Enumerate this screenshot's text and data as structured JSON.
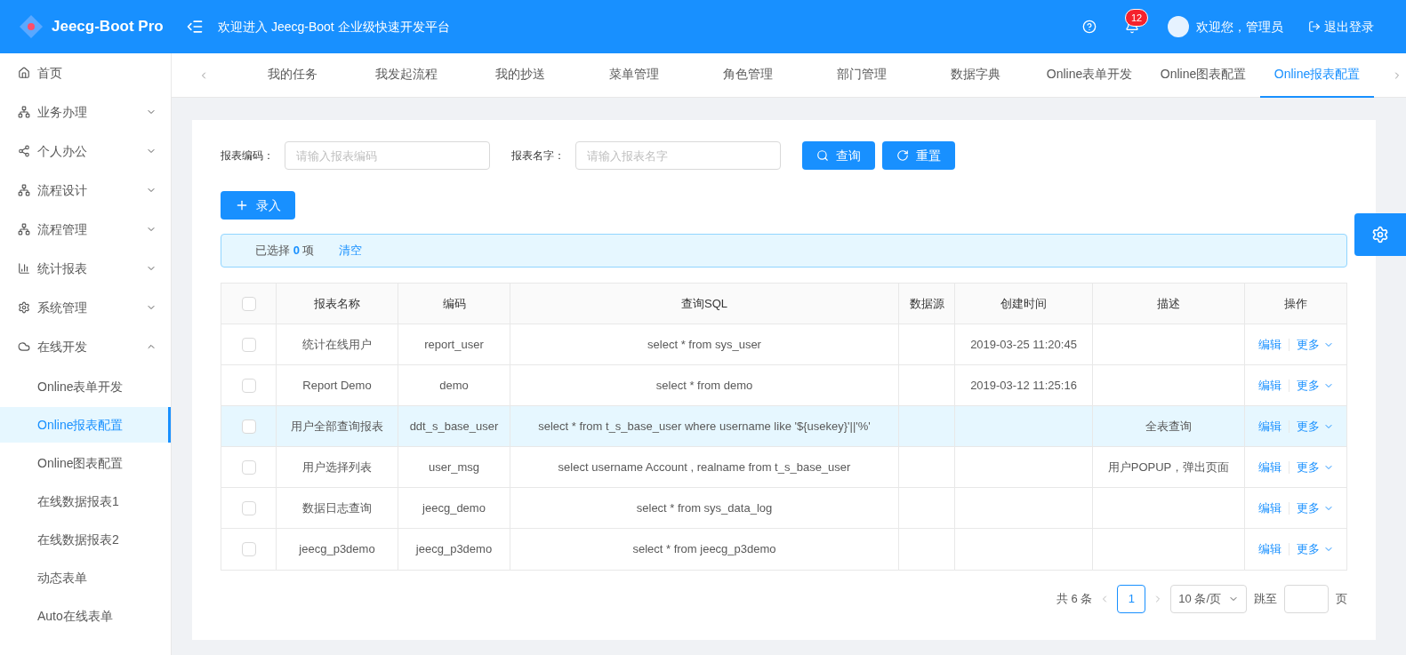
{
  "header": {
    "logo": "Jeecg-Boot Pro",
    "welcome": "欢迎进入 Jeecg-Boot 企业级快速开发平台",
    "notification_count": "12",
    "user": "欢迎您，管理员",
    "logout": "退出登录"
  },
  "sidebar": {
    "items": [
      {
        "label": "首页"
      },
      {
        "label": "业务办理",
        "expanded": false
      },
      {
        "label": "个人办公",
        "expanded": false
      },
      {
        "label": "流程设计",
        "expanded": false
      },
      {
        "label": "流程管理",
        "expanded": false
      },
      {
        "label": "统计报表",
        "expanded": false
      },
      {
        "label": "系统管理",
        "expanded": false
      },
      {
        "label": "在线开发",
        "expanded": true,
        "children": [
          {
            "label": "Online表单开发",
            "selected": false
          },
          {
            "label": "Online报表配置",
            "selected": true
          },
          {
            "label": "Online图表配置",
            "selected": false
          },
          {
            "label": "在线数据报表1",
            "selected": false
          },
          {
            "label": "在线数据报表2",
            "selected": false
          },
          {
            "label": "动态表单",
            "selected": false
          },
          {
            "label": "Auto在线表单",
            "selected": false
          }
        ]
      }
    ]
  },
  "tabs": [
    {
      "label": "我的任务",
      "selected": false
    },
    {
      "label": "我发起流程",
      "selected": false
    },
    {
      "label": "我的抄送",
      "selected": false
    },
    {
      "label": "菜单管理",
      "selected": false
    },
    {
      "label": "角色管理",
      "selected": false
    },
    {
      "label": "部门管理",
      "selected": false
    },
    {
      "label": "数据字典",
      "selected": false
    },
    {
      "label": "Online表单开发",
      "selected": false
    },
    {
      "label": "Online图表配置",
      "selected": false
    },
    {
      "label": "Online报表配置",
      "selected": true
    }
  ],
  "search": {
    "fields": [
      {
        "label": "报表编码：",
        "placeholder": "请输入报表编码"
      },
      {
        "label": "报表名字：",
        "placeholder": "请输入报表名字"
      }
    ],
    "query_button": "查询",
    "reset_button": "重置",
    "add_button": "录入"
  },
  "selection": {
    "prefix": "已选择",
    "count": "0",
    "suffix": "项",
    "clear": "清空"
  },
  "table": {
    "header_checked": false,
    "columns": [
      "报表名称",
      "编码",
      "查询SQL",
      "数据源",
      "创建时间",
      "描述",
      "操作"
    ],
    "rows": [
      {
        "checked": false,
        "highlighted": false,
        "cells": [
          "统计在线用户",
          "report_user",
          "select * from sys_user",
          "",
          "2019-03-25 11:20:45",
          ""
        ],
        "edit": "编辑",
        "more": "更多"
      },
      {
        "checked": false,
        "highlighted": false,
        "cells": [
          "Report Demo",
          "demo",
          "select * from demo",
          "",
          "2019-03-12 11:25:16",
          ""
        ],
        "edit": "编辑",
        "more": "更多"
      },
      {
        "checked": false,
        "highlighted": true,
        "cells": [
          "用户全部查询报表",
          "ddt_s_base_user",
          "select * from t_s_base_user where username like '${usekey}'||'%'",
          "",
          "",
          "全表查询"
        ],
        "edit": "编辑",
        "more": "更多"
      },
      {
        "checked": false,
        "highlighted": false,
        "cells": [
          "用户选择列表",
          "user_msg",
          "select username Account , realname from t_s_base_user",
          "",
          "",
          "用户POPUP，弹出页面"
        ],
        "edit": "编辑",
        "more": "更多"
      },
      {
        "checked": false,
        "highlighted": false,
        "cells": [
          "数据日志查询",
          "jeecg_demo",
          "select * from sys_data_log",
          "",
          "",
          ""
        ],
        "edit": "编辑",
        "more": "更多"
      },
      {
        "checked": false,
        "highlighted": false,
        "cells": [
          "jeecg_p3demo",
          "jeecg_p3demo",
          "select * from jeecg_p3demo",
          "",
          "",
          ""
        ],
        "edit": "编辑",
        "more": "更多"
      }
    ]
  },
  "pagination": {
    "total": "共 6 条",
    "current_page": "1",
    "page_size": "10 条/页",
    "jump_label": "跳至",
    "page_suffix": "页"
  }
}
